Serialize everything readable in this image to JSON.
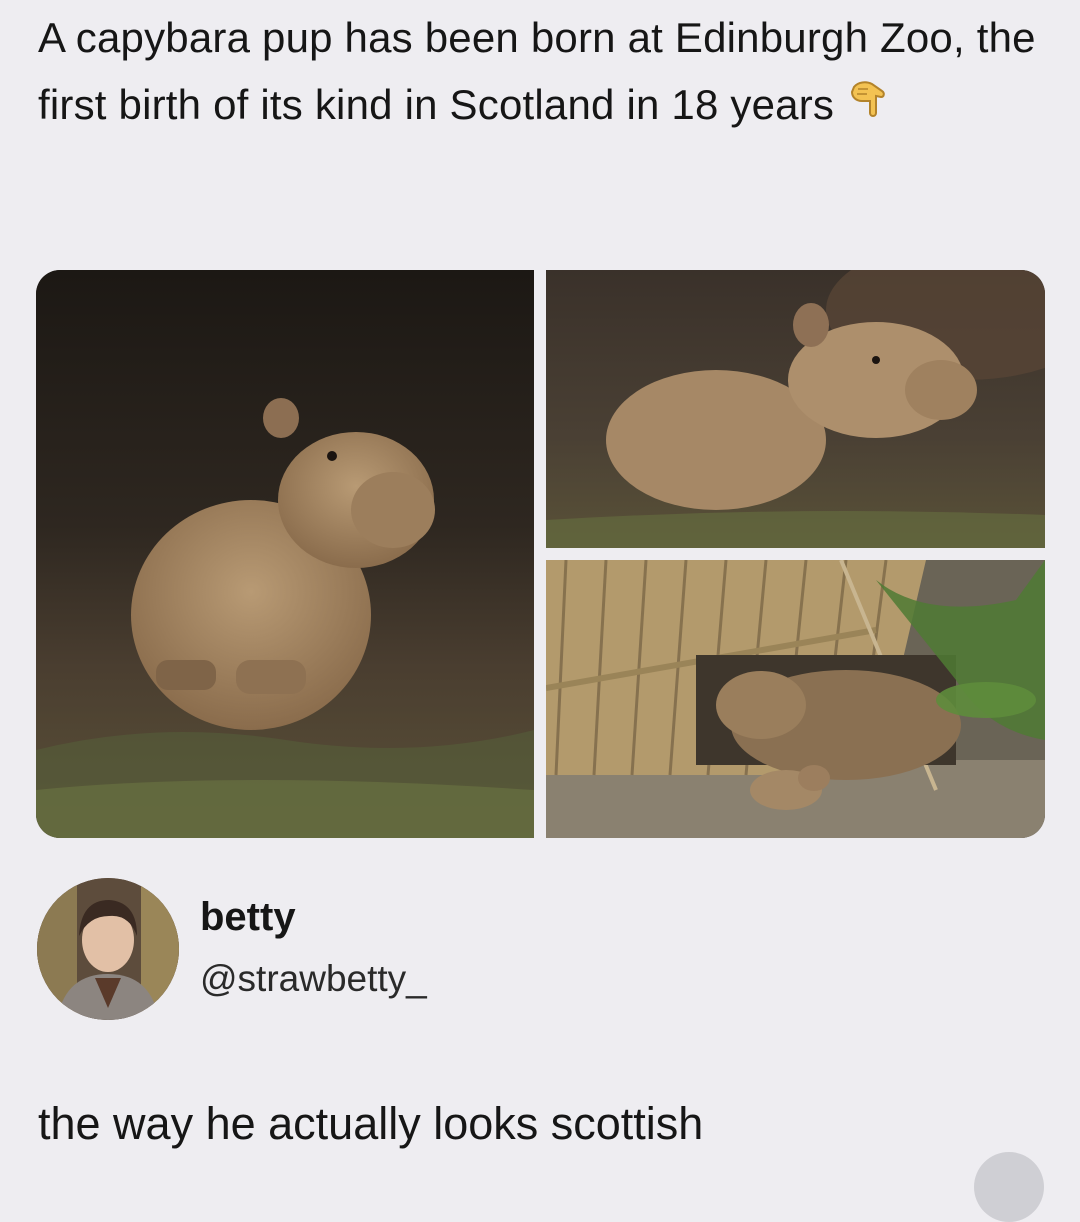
{
  "post": {
    "headline": "A capybara pup has been born at Edinburgh Zoo, the first birth of its kind in Scotland in 18 years",
    "headline_emoji": "pointing-down-hand-icon"
  },
  "media": {
    "photos": [
      {
        "name": "capybara-pup-front"
      },
      {
        "name": "capybara-pup-side"
      },
      {
        "name": "capybara-adult-and-pup-under-shelter"
      }
    ]
  },
  "author": {
    "display_name": "betty",
    "handle": "@strawbetty_"
  },
  "reply": {
    "text": "the way he actually looks scottish"
  },
  "colors": {
    "background": "#eeedf1",
    "text": "#161616",
    "capybara_fur": "#a88a66"
  }
}
